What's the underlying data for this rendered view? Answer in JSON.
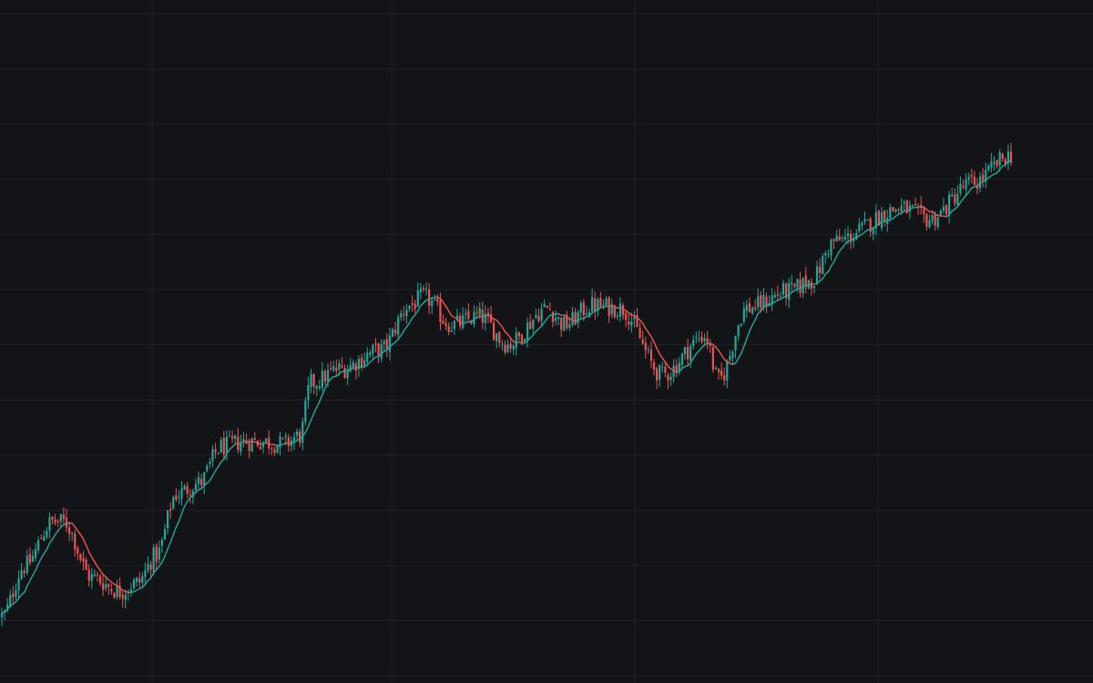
{
  "colors": {
    "background": "#131418",
    "grid": "#1f2126",
    "up": "#26a69a",
    "down": "#ef5350"
  },
  "chart_data": {
    "type": "candlestick",
    "series": [
      {
        "name": "",
        "kind": "ohlc",
        "interval": "bar",
        "count": 360
      },
      {
        "name": "",
        "kind": "moving-average"
      }
    ],
    "ylim": [
      2,
      14.3
    ],
    "grid": true,
    "legend": "none",
    "anchors": [
      [
        0,
        3.2
      ],
      [
        8,
        4.1
      ],
      [
        18,
        4.9
      ],
      [
        22,
        4.9
      ],
      [
        32,
        3.9
      ],
      [
        42,
        3.65
      ],
      [
        48,
        3.8
      ],
      [
        55,
        4.3
      ],
      [
        62,
        5.4
      ],
      [
        70,
        5.6
      ],
      [
        78,
        6.25
      ],
      [
        86,
        6.35
      ],
      [
        92,
        6.35
      ],
      [
        100,
        6.3
      ],
      [
        106,
        6.45
      ],
      [
        110,
        7.4
      ],
      [
        120,
        7.65
      ],
      [
        135,
        8.0
      ],
      [
        145,
        8.8
      ],
      [
        150,
        8.95
      ],
      [
        160,
        8.45
      ],
      [
        170,
        8.6
      ],
      [
        180,
        8.1
      ],
      [
        194,
        8.75
      ],
      [
        200,
        8.45
      ],
      [
        210,
        8.8
      ],
      [
        220,
        8.75
      ],
      [
        235,
        7.55
      ],
      [
        250,
        8.25
      ],
      [
        255,
        7.45
      ],
      [
        265,
        8.75
      ],
      [
        280,
        9.05
      ],
      [
        288,
        9.25
      ],
      [
        296,
        9.95
      ],
      [
        320,
        10.55
      ],
      [
        330,
        10.35
      ],
      [
        345,
        11.0
      ],
      [
        359,
        11.5
      ]
    ]
  }
}
